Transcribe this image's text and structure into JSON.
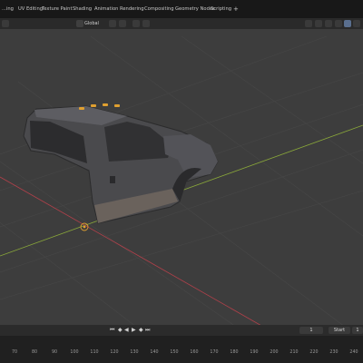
{
  "workspace_tabs": [
    "...ing",
    "UV Editing",
    "Texture Paint",
    "Shading",
    "Animation",
    "Rendering",
    "Compositing",
    "Geometry Nodes",
    "Scripting"
  ],
  "workspace_add": "+",
  "viewport_header": {
    "transform_orientation": "Global"
  },
  "timeline": {
    "current_frame": "1",
    "start_label": "Start",
    "end_value": "1",
    "ruler_ticks": [
      "70",
      "80",
      "90",
      "100",
      "110",
      "120",
      "130",
      "140",
      "150",
      "160",
      "170",
      "180",
      "190",
      "200",
      "210",
      "220",
      "230",
      "240"
    ]
  },
  "colors": {
    "viewport_bg": "#3d3d3d",
    "x_axis": "#b0404a",
    "y_axis": "#8aa83a",
    "grid": "#474747",
    "object_origin": "#e0a030"
  }
}
